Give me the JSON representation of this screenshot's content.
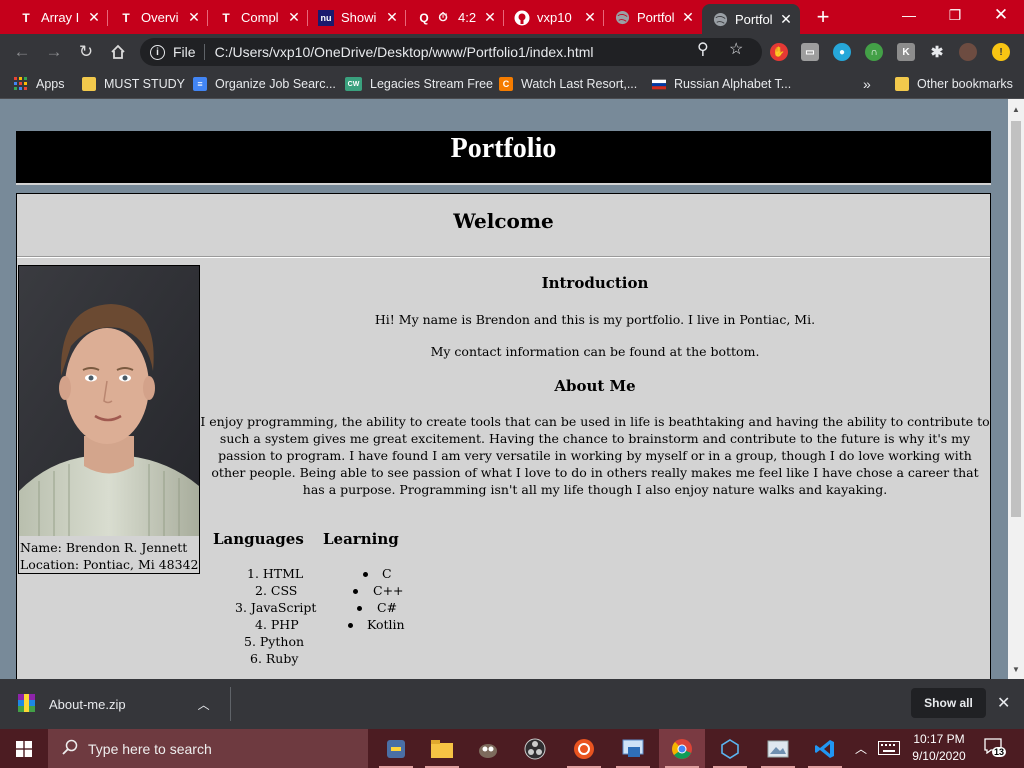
{
  "tabs": [
    {
      "title": "Array I",
      "icon": "T"
    },
    {
      "title": "Overvi",
      "icon": "T"
    },
    {
      "title": "Compl",
      "icon": "T"
    },
    {
      "title": "Showi",
      "icon": "nu"
    },
    {
      "title": "4:2",
      "icon": "Q"
    },
    {
      "title": "vxp10",
      "icon": "github"
    },
    {
      "title": "Portfol",
      "icon": "globe"
    },
    {
      "title": "Portfol",
      "icon": "globe"
    }
  ],
  "toolbar": {
    "file_label": "File",
    "url": "C:/Users/vxp10/OneDrive/Desktop/www/Portfolio1/index.html"
  },
  "bookmarks": {
    "items": [
      "Apps",
      "MUST STUDY",
      "Organize Job Searc...",
      "Legacies Stream Free",
      "Watch Last Resort,...",
      "Russian Alphabet T..."
    ],
    "overflow": "»",
    "other": "Other bookmarks"
  },
  "page": {
    "banner": "Portfolio",
    "welcome": "Welcome",
    "profile_name": "Name: Brendon R. Jennett",
    "profile_location": "Location: Pontiac, Mi 48342",
    "intro_heading": "Introduction",
    "intro_line1": "Hi! My name is Brendon and this is my portfolio. I live in Pontiac, Mi.",
    "intro_line2": "My contact information can be found at the bottom.",
    "about_heading": "About Me",
    "about_text": "I enjoy programming, the ability to create tools that can be used in life is beathtaking and having the ability to contribute to such a system gives me great excitement. Having the chance to brainstorm and contribute to the future is why it's my passion to program. I have found I am very versatile in working by myself or in a group, though I do love working with other people. Being able to see passion of what I love to do in others really makes me feel like I have chose a career that has a purpose. Programming isn't all my life though I also enjoy nature walks and kayaking.",
    "languages_heading": "Languages",
    "languages": [
      "1. HTML",
      "2. CSS",
      "3. JavaScript",
      "4. PHP",
      "5. Python",
      "6. Ruby"
    ],
    "learning_heading": "Learning",
    "learning": [
      "C",
      "C++",
      "C#",
      "Kotlin"
    ]
  },
  "download": {
    "filename": "About-me.zip",
    "show_all": "Show all"
  },
  "taskbar": {
    "search_placeholder": "Type here to search",
    "time": "10:17 PM",
    "date": "9/10/2020",
    "notifications": "13"
  },
  "colors": {
    "tabstrip": "#c5001b",
    "page_bg": "#788a99",
    "content_bg": "#d3d3d3",
    "taskbar": "#4c1c22"
  }
}
